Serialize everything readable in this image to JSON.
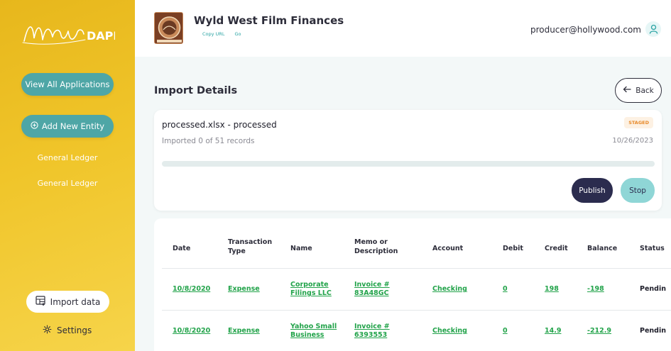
{
  "sidebar": {
    "logo_text": "MAGIC DAPP",
    "view_all_label": "View All Applications",
    "add_entity_label": "Add New Entity",
    "nav_items": [
      "General Ledger",
      "General Ledger"
    ],
    "import_label": "Import data",
    "settings_label": "Settings"
  },
  "header": {
    "company_name": "Wyld West Film Finances",
    "copy_url_label": "Copy URL",
    "go_label": "Go",
    "user_email": "producer@hollywood.com"
  },
  "main": {
    "title": "Import Details",
    "back_label": "Back",
    "import": {
      "file_title": "processed.xlsx - processed",
      "status_badge": "STAGED",
      "records_text": "Imported 0 of 51 records",
      "date": "10/26/2023",
      "progress": 0,
      "publish_label": "Publish",
      "stop_label": "Stop"
    },
    "table": {
      "headers": [
        "Date",
        "Transaction Type",
        "Name",
        "Memo or Description",
        "Account",
        "Debit",
        "Credit",
        "Balance",
        "Status"
      ],
      "rows": [
        [
          "10/8/2020",
          "Expense",
          "Corporate Filings LLC",
          "Invoice # 83A48GC",
          "Checking",
          "0",
          "198",
          "-198",
          "Pendin"
        ],
        [
          "10/8/2020",
          "Expense",
          "Yahoo Small Business",
          "Invoice # 6393553",
          "Checking",
          "0",
          "14.9",
          "-212.9",
          "Pendin"
        ]
      ]
    }
  },
  "colors": {
    "sidebar_yellow": "#f0c52a",
    "teal": "#4ea6a6",
    "navy": "#2b2c4e",
    "link_green": "#22a34a",
    "staged_orange": "#e88a2a"
  }
}
